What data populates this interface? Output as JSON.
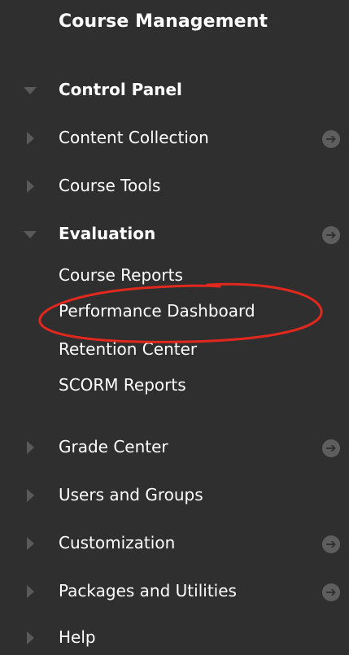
{
  "header": {
    "title": "Course Management"
  },
  "menu": {
    "control_panel": "Control Panel",
    "content_collection": "Content Collection",
    "course_tools": "Course Tools",
    "evaluation": {
      "label": "Evaluation",
      "items": [
        "Course Reports",
        "Performance Dashboard",
        "Retention Center",
        "SCORM Reports"
      ]
    },
    "grade_center": "Grade Center",
    "users_and_groups": "Users and Groups",
    "customization": "Customization",
    "packages_and_utilities": "Packages and Utilities",
    "help": "Help"
  },
  "colors": {
    "background": "#2f2f2f",
    "icon_gray": "#5a5a5a",
    "annotation_red": "#e0281f"
  },
  "icons": {
    "expanded": "caret-down-icon",
    "collapsed": "caret-right-icon",
    "go": "circle-arrow-right-icon"
  }
}
